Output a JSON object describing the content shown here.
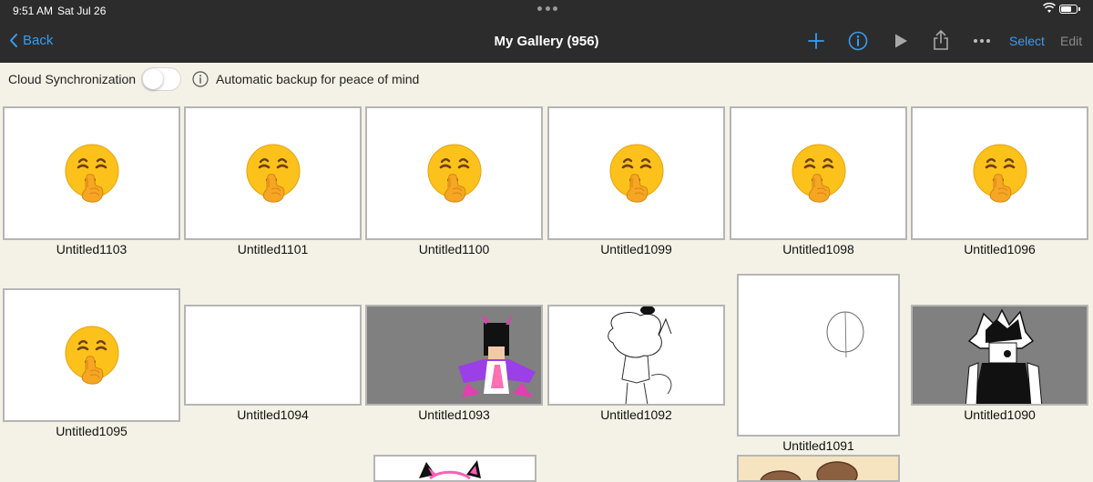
{
  "status": {
    "time": "9:51 AM",
    "date": "Sat Jul 26"
  },
  "nav": {
    "back_label": "Back",
    "title": "My Gallery (956)",
    "select_label": "Select",
    "edit_label": "Edit",
    "icons": [
      "plus-icon",
      "info-icon",
      "play-icon",
      "share-icon",
      "more-icon"
    ]
  },
  "sync": {
    "label": "Cloud Synchronization",
    "enabled": false,
    "info_text": "Automatic backup for peace of mind"
  },
  "colors": {
    "accent": "#3a9cf0",
    "nav_bg": "#2c2c2c",
    "page_bg": "#f4f2e6"
  },
  "gallery": {
    "items": [
      {
        "name": "Untitled1103",
        "thumbnail": "shushing-face-emoji"
      },
      {
        "name": "Untitled1101",
        "thumbnail": "shushing-face-emoji"
      },
      {
        "name": "Untitled1100",
        "thumbnail": "shushing-face-emoji"
      },
      {
        "name": "Untitled1099",
        "thumbnail": "shushing-face-emoji"
      },
      {
        "name": "Untitled1098",
        "thumbnail": "shushing-face-emoji"
      },
      {
        "name": "Untitled1096",
        "thumbnail": "shushing-face-emoji"
      },
      {
        "name": "Untitled1095",
        "thumbnail": "shushing-face-emoji"
      },
      {
        "name": "Untitled1094",
        "thumbnail": "blank"
      },
      {
        "name": "Untitled1093",
        "thumbnail": "character-drawing"
      },
      {
        "name": "Untitled1092",
        "thumbnail": "line-sketch"
      },
      {
        "name": "Untitled1091",
        "thumbnail": "circle-sketch"
      },
      {
        "name": "Untitled1090",
        "thumbnail": "character-drawing"
      },
      {
        "name": "",
        "thumbnail": "character-drawing"
      },
      {
        "name": "",
        "thumbnail": "character-drawing"
      }
    ]
  }
}
